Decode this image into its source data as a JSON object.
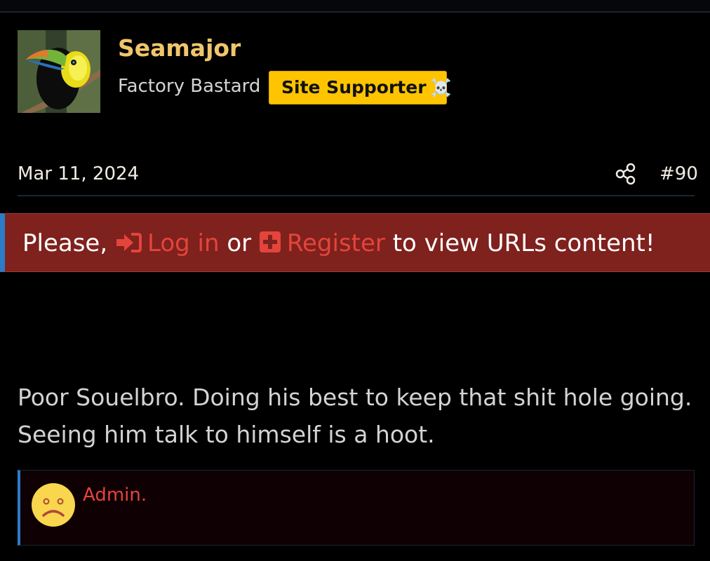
{
  "post": {
    "username": "Seamajor",
    "user_title": "Factory Bastard",
    "badge": {
      "label": "Site Supporter",
      "emoji": "☠️"
    },
    "date": "Mar 11, 2024",
    "post_number": "#90",
    "message_lines": [
      "Poor Souelbro. Doing his best to keep that shit hole going.",
      "Seeing him talk to himself is a hoot."
    ]
  },
  "notice": {
    "prefix": "Please,",
    "login_label": "Log in",
    "or_text": "or",
    "register_label": "Register",
    "suffix": "to view URLs content!"
  },
  "quote": {
    "text": "Admin."
  },
  "colors": {
    "username": "#f0c66b",
    "badge": "#ffc400",
    "notice_bg": "#7f211d",
    "link_red": "#e4443b",
    "accent_blue": "#2b7cc7"
  },
  "icons": {
    "avatar": "toucan-avatar",
    "share": "share-icon",
    "login": "login-arrow-icon",
    "register": "plus-square-icon",
    "quote": "sad-face-emoji"
  }
}
